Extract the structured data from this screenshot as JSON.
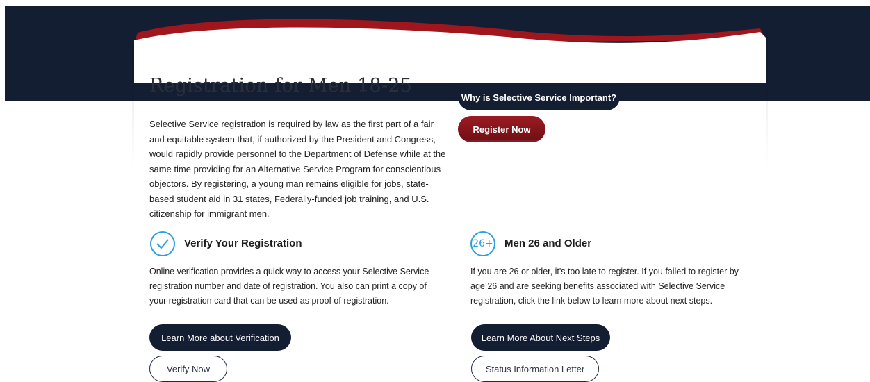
{
  "hero": {
    "title": "Registration for Men 18-25",
    "intro": "Selective Service registration is required by law as the first part of a fair and equitable system that, if authorized by the President and Congress, would rapidly provide personnel to the Department of Defense while at the same time providing for an Alternative Service Program for conscientious objectors. By registering, a young man remains eligible for jobs, state-based student aid in 31 states, Federally-funded job training, and U.S. citizenship for immigrant men.",
    "why_button": "Why is Selective Service Important?",
    "register_button": "Register Now"
  },
  "verify": {
    "icon": "checkmark-circle-icon",
    "title": "Verify Your Registration",
    "body": "Online verification provides a quick way to access your Selective Service registration number and date of registration. You also can print a copy of your registration card that can be used as proof of registration.",
    "primary_button": "Learn More about Verification",
    "secondary_button": "Verify Now"
  },
  "older": {
    "icon": "age-26-plus-icon",
    "badge": "26+",
    "title": "Men 26 and Older",
    "body": "If you are 26 or older, it's too late to register. If you failed to register by age 26 and are seeking benefits associated with Selective Service registration, click the link below to learn more about next steps.",
    "primary_button": "Learn More About Next Steps",
    "secondary_button": "Status Information Letter"
  },
  "colors": {
    "navy": "#141e33",
    "red": "#8b1a1f",
    "icon_blue": "#2d9ee0"
  }
}
